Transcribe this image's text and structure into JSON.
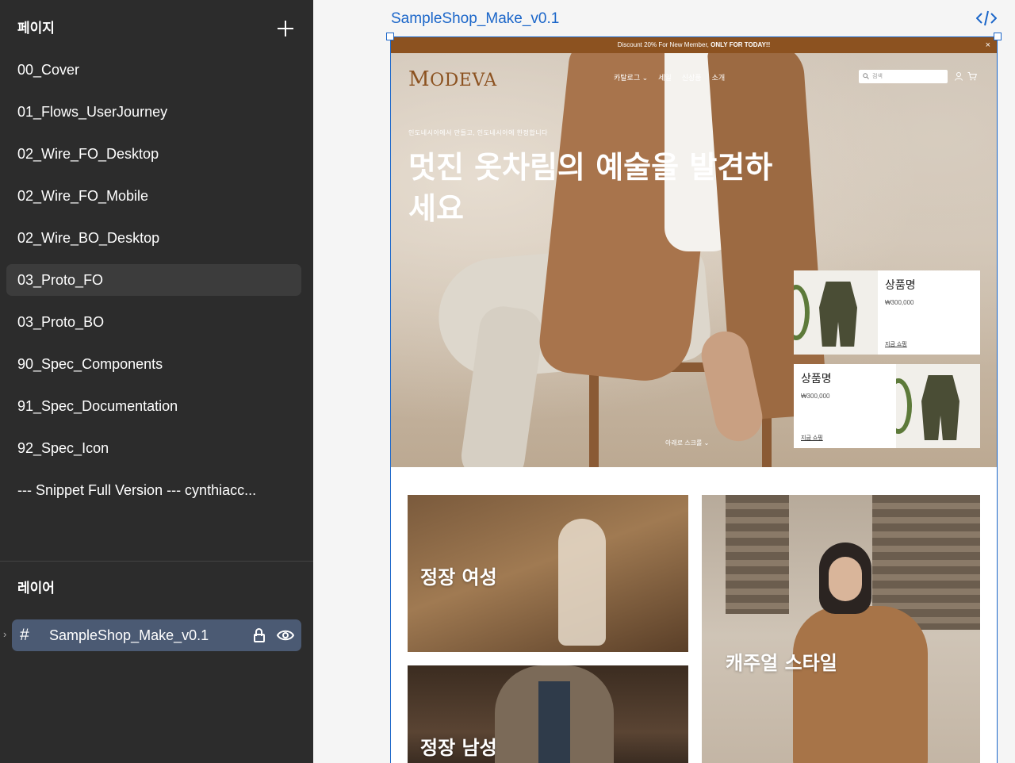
{
  "sidebar": {
    "pages_title": "페이지",
    "pages": [
      {
        "label": "00_Cover"
      },
      {
        "label": "01_Flows_UserJourney"
      },
      {
        "label": "02_Wire_FO_Desktop"
      },
      {
        "label": "02_Wire_FO_Mobile"
      },
      {
        "label": "02_Wire_BO_Desktop"
      },
      {
        "label": "03_Proto_FO",
        "active": true
      },
      {
        "label": "03_Proto_BO"
      },
      {
        "label": "90_Spec_Components"
      },
      {
        "label": "91_Spec_Documentation"
      },
      {
        "label": "92_Spec_Icon"
      },
      {
        "label": "--- Snippet Full Version --- cynthiacc..."
      }
    ],
    "layers_title": "레이어",
    "layer": {
      "name": "SampleShop_Make_v0.1"
    }
  },
  "canvas": {
    "frame_label": "SampleShop_Make_v0.1"
  },
  "shop": {
    "promo": {
      "text": "Discount 20% For New Member, ",
      "bold": "ONLY FOR TODAY!!",
      "close": "×"
    },
    "logo": {
      "first": "M",
      "rest": "ODEVA"
    },
    "nav": [
      "카탈로그 ⌄",
      "세일",
      "신상품",
      "소개"
    ],
    "search_placeholder": "검색",
    "hero": {
      "subtitle": "인도네시아에서 만들고, 인도네시아에 한정합니다",
      "title": "멋진 옷차림의 예술을 발견하세요",
      "scroll_hint": "아래로 스크롤 ⌄"
    },
    "products": [
      {
        "name": "상품명",
        "price": "₩300,000",
        "cta": "지금 쇼핑"
      },
      {
        "name": "상품명",
        "price": "₩300,000",
        "cta": "지금 쇼핑"
      }
    ],
    "categories": [
      {
        "label": "정장 여성"
      },
      {
        "label": "정장 남성"
      },
      {
        "label": "캐주얼 스타일"
      }
    ]
  },
  "colors": {
    "sidebar_bg": "#2c2c2c",
    "selection_blue": "#1b66c9",
    "brand_brown": "#8c5220",
    "layer_highlight": "#4b5a73"
  },
  "icons": [
    "add-icon",
    "frame-icon",
    "lock-icon",
    "eye-icon",
    "code-icon",
    "search-icon",
    "user-icon",
    "cart-icon",
    "close-icon"
  ]
}
